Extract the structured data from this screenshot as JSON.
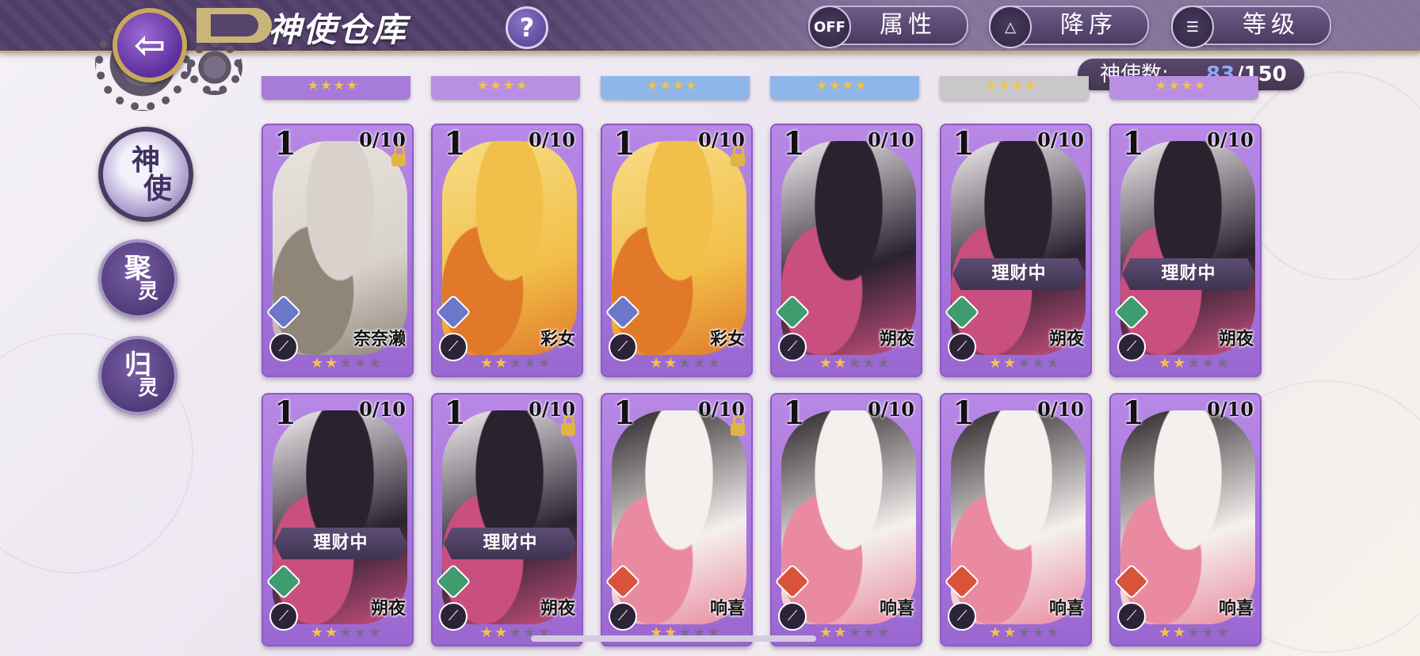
{
  "header": {
    "title": "神使仓库",
    "help_label": "?",
    "attr_toggle": {
      "state": "OFF",
      "label": "属性"
    },
    "order_btn": {
      "icon": "sort-updown-icon",
      "label": "降序"
    },
    "sort_btn": {
      "icon": "sort-lines-icon",
      "label": "等级"
    },
    "count": {
      "label": "神使数:",
      "current": "83",
      "total": "/150"
    }
  },
  "sidebar": {
    "items": [
      {
        "top": "神",
        "bottom": "使",
        "active": true
      },
      {
        "top": "聚",
        "bottom": "灵",
        "active": false
      },
      {
        "top": "归",
        "bottom": "灵",
        "active": false
      }
    ]
  },
  "partial_row": [
    {
      "color": "#a77bd8"
    },
    {
      "color": "#b98fe4"
    },
    {
      "color": "#8fb6e8"
    },
    {
      "color": "#8fb6e8"
    },
    {
      "color": "#c8c8c8"
    },
    {
      "color": "#b98fe4"
    }
  ],
  "cards": [
    {
      "level": "1",
      "progress": "0/10",
      "locked": true,
      "banner": "",
      "name": "奈奈濑",
      "stars": 2,
      "max_stars": 5,
      "element": "#6b78c9",
      "art": [
        "#d9d2cc",
        "#8f8579",
        "#e9e3dd"
      ]
    },
    {
      "level": "1",
      "progress": "0/10",
      "locked": false,
      "banner": "",
      "name": "彩女",
      "stars": 2,
      "max_stars": 5,
      "element": "#6b78c9",
      "art": [
        "#f2c04a",
        "#e07a2a",
        "#f7dc86"
      ]
    },
    {
      "level": "1",
      "progress": "0/10",
      "locked": true,
      "banner": "",
      "name": "彩女",
      "stars": 2,
      "max_stars": 5,
      "element": "#6b78c9",
      "art": [
        "#f2c04a",
        "#e07a2a",
        "#f7dc86"
      ]
    },
    {
      "level": "1",
      "progress": "0/10",
      "locked": false,
      "banner": "",
      "name": "朔夜",
      "stars": 2,
      "max_stars": 5,
      "element": "#3f9c6e",
      "art": [
        "#2b2230",
        "#c94f7e",
        "#f3eef0"
      ]
    },
    {
      "level": "1",
      "progress": "0/10",
      "locked": false,
      "banner": "理财中",
      "name": "朔夜",
      "stars": 2,
      "max_stars": 5,
      "element": "#3f9c6e",
      "art": [
        "#2b2230",
        "#c94f7e",
        "#f3eef0"
      ]
    },
    {
      "level": "1",
      "progress": "0/10",
      "locked": false,
      "banner": "理财中",
      "name": "朔夜",
      "stars": 2,
      "max_stars": 5,
      "element": "#3f9c6e",
      "art": [
        "#2b2230",
        "#c94f7e",
        "#f3eef0"
      ]
    },
    {
      "level": "1",
      "progress": "0/10",
      "locked": false,
      "banner": "理财中",
      "name": "朔夜",
      "stars": 2,
      "max_stars": 5,
      "element": "#3f9c6e",
      "art": [
        "#2b2230",
        "#c94f7e",
        "#f3eef0"
      ]
    },
    {
      "level": "1",
      "progress": "0/10",
      "locked": true,
      "banner": "理财中",
      "name": "朔夜",
      "stars": 2,
      "max_stars": 5,
      "element": "#3f9c6e",
      "art": [
        "#2b2230",
        "#c94f7e",
        "#f3eef0"
      ]
    },
    {
      "level": "1",
      "progress": "0/10",
      "locked": true,
      "banner": "",
      "name": "响喜",
      "stars": 2,
      "max_stars": 5,
      "element": "#d9533a",
      "art": [
        "#f4f0ee",
        "#e98aa0",
        "#2a2428"
      ]
    },
    {
      "level": "1",
      "progress": "0/10",
      "locked": false,
      "banner": "",
      "name": "响喜",
      "stars": 2,
      "max_stars": 5,
      "element": "#d9533a",
      "art": [
        "#f4f0ee",
        "#e98aa0",
        "#2a2428"
      ]
    },
    {
      "level": "1",
      "progress": "0/10",
      "locked": false,
      "banner": "",
      "name": "响喜",
      "stars": 2,
      "max_stars": 5,
      "element": "#d9533a",
      "art": [
        "#f4f0ee",
        "#e98aa0",
        "#2a2428"
      ]
    },
    {
      "level": "1",
      "progress": "0/10",
      "locked": false,
      "banner": "",
      "name": "响喜",
      "stars": 2,
      "max_stars": 5,
      "element": "#d9533a",
      "art": [
        "#f4f0ee",
        "#e98aa0",
        "#2a2428"
      ]
    }
  ]
}
